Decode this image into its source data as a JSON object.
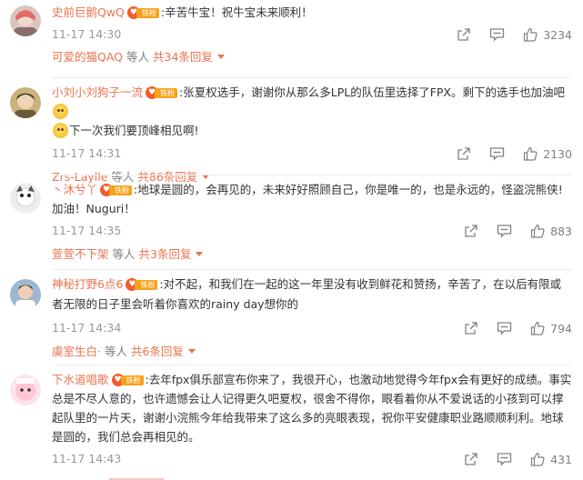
{
  "comments": [
    {
      "username": "史前巨鹅QwQ",
      "badge": "铁粉",
      "text": ":辛苦牛宝！祝牛宝未来顺利！",
      "time": "11-17 14:30",
      "likes": "3234",
      "reply_user": "可爱的猫QAQ",
      "reply_mid": "等人",
      "reply_count": "共34条回复"
    },
    {
      "username": "小刘小刘狗子一流",
      "badge": "铁粉",
      "text": ":张夏权选手，谢谢你从那么多LPL的队伍里选择了FPX。剩下的选手也加油吧",
      "text2": "下一次我们要顶峰相见啊!",
      "time": "11-17 14:31",
      "likes": "2130",
      "reply_user": "Zrs-Laylle",
      "reply_mid": "等人",
      "reply_count": "共86条回复"
    },
    {
      "username": "丶沐兮丫",
      "badge": "铁粉",
      "text": ":地球是圆的，会再见的，未来好好照顾自己，你是唯一的，也是永远的，怪盗浣熊侠!",
      "text2": "加油！Nuguri！",
      "time": "11-17 14:35",
      "likes": "883",
      "reply_user": "萱萱不下架",
      "reply_mid": "等人",
      "reply_count": "共3条回复"
    },
    {
      "username": "神秘打野6点6",
      "badge": "铁粉",
      "text": ":对不起，和我们在一起的这一年里没有收到鲜花和赞扬，辛苦了，在以后有限或者无限的日子里会听着你喜欢的rainy day想你的",
      "time": "11-17 14:34",
      "likes": "794",
      "reply_user": "虞室生白·",
      "reply_mid": "等人",
      "reply_count": "共6条回复"
    },
    {
      "username": "下水道唱歌",
      "badge": "铁粉",
      "text": ":去年fpx俱乐部宣布你来了，我很开心，也激动地觉得今年fpx会有更好的成绩。事实总是不尽人意的，也许遗憾会让人记得更久吧夏权，很舍不得你，眼看着你从不爱说话的小孩到可以撑起队里的一片天，谢谢小浣熊今年给我带来了这么多的亮眼表现，祝你平安健康职业路顺顺利利。地球是圆的，我们总会再相见的。",
      "time": "11-17 14:43",
      "likes": "431"
    }
  ],
  "colors": {
    "username": "#eb7350",
    "meta": "#999999",
    "icon": "#808080"
  }
}
